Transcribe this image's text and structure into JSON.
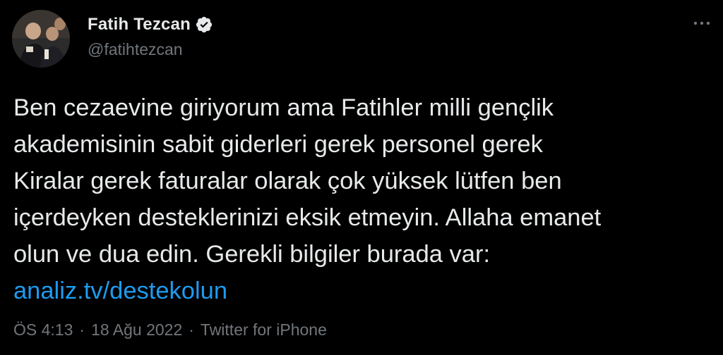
{
  "author": {
    "display_name": "Fatih Tezcan",
    "handle": "@fatihtezcan",
    "verified": true,
    "verified_color": "#e7e9ea"
  },
  "tweet": {
    "lines": [
      "Ben cezaevine giriyorum ama Fatihler milli gençlik",
      "akademisinin sabit giderleri gerek personel gerek",
      "Kiralar gerek faturalar olarak çok yüksek lütfen ben",
      "içerdeyken desteklerinizi eksik etmeyin. Allaha emanet",
      "olun ve dua edin. Gerekli bilgiler burada var:"
    ],
    "link_text": "analiz.tv/destekolun",
    "link_color": "#1d9bf0"
  },
  "meta": {
    "time": "ÖS 4:13",
    "separator": "·",
    "date": "18 Ağu 2022",
    "source": "Twitter for iPhone"
  },
  "icons": {
    "avatar": "profile-photo",
    "verified": "verified-badge-icon",
    "more": "more-options-icon"
  },
  "colors": {
    "background": "#000000",
    "text_primary": "#e7e9ea",
    "text_secondary": "#71767b"
  }
}
